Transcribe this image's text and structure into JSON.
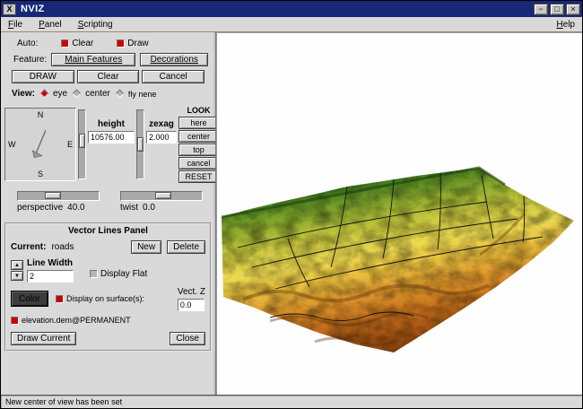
{
  "window": {
    "title": "NVIZ",
    "icon_glyph": "X",
    "controls": {
      "minimize": "−",
      "maximize": "□",
      "close": "×"
    },
    "statusbar": "New center of view has been set"
  },
  "menubar": {
    "items": [
      {
        "label": "File"
      },
      {
        "label": "Panel"
      },
      {
        "label": "Scripting"
      },
      {
        "label": "Help"
      }
    ]
  },
  "panel": {
    "auto": {
      "label": "Auto:",
      "clear": "Clear",
      "draw": "Draw"
    },
    "feature": {
      "label": "Feature:",
      "main": "Main Features",
      "decorations": "Decorations"
    },
    "actions": {
      "draw": "DRAW",
      "clear": "Clear",
      "cancel": "Cancel"
    },
    "view": {
      "label": "View:",
      "eye": "eye",
      "center": "center",
      "fly": "fly nene"
    },
    "compass": {
      "n": "N",
      "s": "S",
      "e": "E",
      "w": "W"
    },
    "height": {
      "label": "height",
      "value": "10576.00"
    },
    "zexag": {
      "label": "zexag",
      "value": "2.000"
    },
    "look": {
      "title": "LOOK",
      "here": "here",
      "center": "center",
      "top": "top",
      "cancel": "cancel",
      "reset": "RESET"
    },
    "perspective": {
      "label": "perspective",
      "value": "40.0"
    },
    "twist": {
      "label": "twist",
      "value": "0.0"
    },
    "vector": {
      "title": "Vector Lines Panel",
      "current_label": "Current:",
      "current_value": "roads",
      "new": "New",
      "delete": "Delete",
      "line_width_label": "Line Width",
      "line_width_value": "2",
      "display_flat": "Display Flat",
      "color": "Color",
      "display_on": "Display on surface(s):",
      "vect_z_label": "Vect. Z",
      "vect_z_value": "0.0",
      "surface": "elevation.dem@PERMANENT",
      "draw_current": "Draw Current",
      "close": "Close"
    }
  },
  "icons": {
    "spin_up": "▲",
    "spin_down": "▼"
  },
  "colors": {
    "titlebar": "#182878",
    "panel_bg": "#d9d9d9",
    "check_on": "#cc0000",
    "canvas_bg": "#fefefe",
    "terrain_high": "#2a6317",
    "terrain_mid": "#ecd94f",
    "terrain_low": "#6f380a",
    "roads": "#101010"
  }
}
